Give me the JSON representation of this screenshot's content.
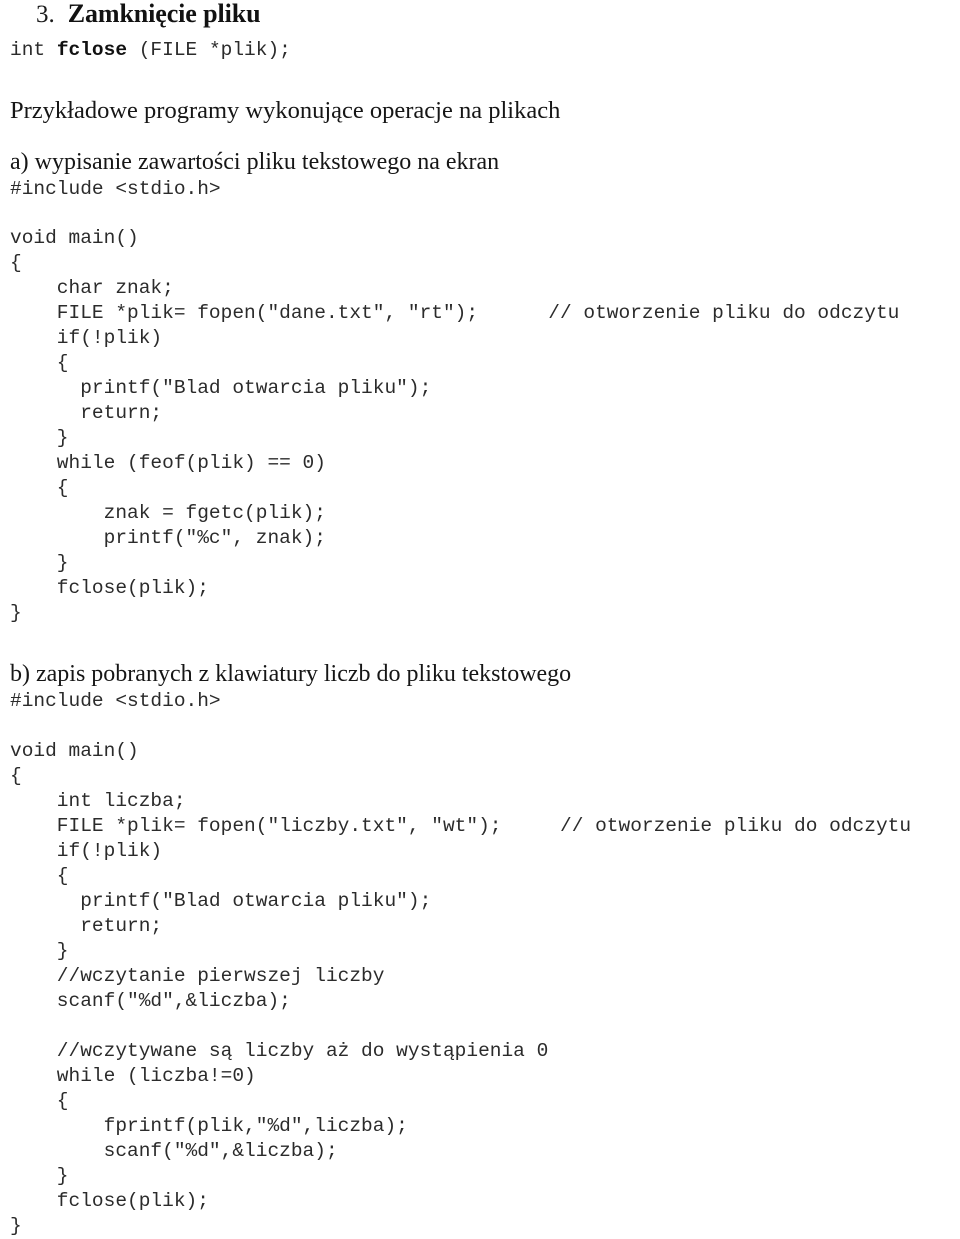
{
  "document": {
    "language": "pl",
    "section": {
      "number": "3.",
      "title": "Zamknięcie pliku"
    },
    "signature": {
      "before": "int ",
      "name": "fclose",
      "after": " (FILE *plik);"
    },
    "intro_heading": "Przykładowe programy wykonujące operacje na plikach",
    "examples": [
      {
        "id": "a",
        "heading": "a) wypisanie zawartości pliku tekstowego na ekran",
        "include": "#include <stdio.h>",
        "code_lines": [
          "void main()",
          "{",
          "    char znak;",
          "    FILE *plik= fopen(\"dane.txt\", \"rt\");      // otworzenie pliku do odczytu",
          "    if(!plik)",
          "    {",
          "      printf(\"Blad otwarcia pliku\");",
          "      return;",
          "    }",
          "    while (feof(plik) == 0)",
          "    {",
          "        znak = fgetc(plik);",
          "        printf(\"%c\", znak);",
          "    }",
          "    fclose(plik);",
          "}"
        ]
      },
      {
        "id": "b",
        "heading": "b) zapis pobranych z klawiatury liczb do pliku tekstowego",
        "include": "#include <stdio.h>",
        "code_lines": [
          "void main()",
          "{",
          "    int liczba;",
          "    FILE *plik= fopen(\"liczby.txt\", \"wt\");     // otworzenie pliku do odczytu",
          "    if(!plik)",
          "    {",
          "      printf(\"Blad otwarcia pliku\");",
          "      return;",
          "    }",
          "    //wczytanie pierwszej liczby",
          "    scanf(\"%d\",&liczba);",
          "",
          "    //wczytywane są liczby aż do wystąpienia 0",
          "    while (liczba!=0)",
          "    {",
          "        fprintf(plik,\"%d\",liczba);",
          "        scanf(\"%d\",&liczba);",
          "    }",
          "    fclose(plik);",
          "}"
        ]
      }
    ],
    "colors": {
      "page_background": "#ffffff",
      "body_text": "#1b1b1b",
      "code_text": "#2b2b2b"
    }
  }
}
